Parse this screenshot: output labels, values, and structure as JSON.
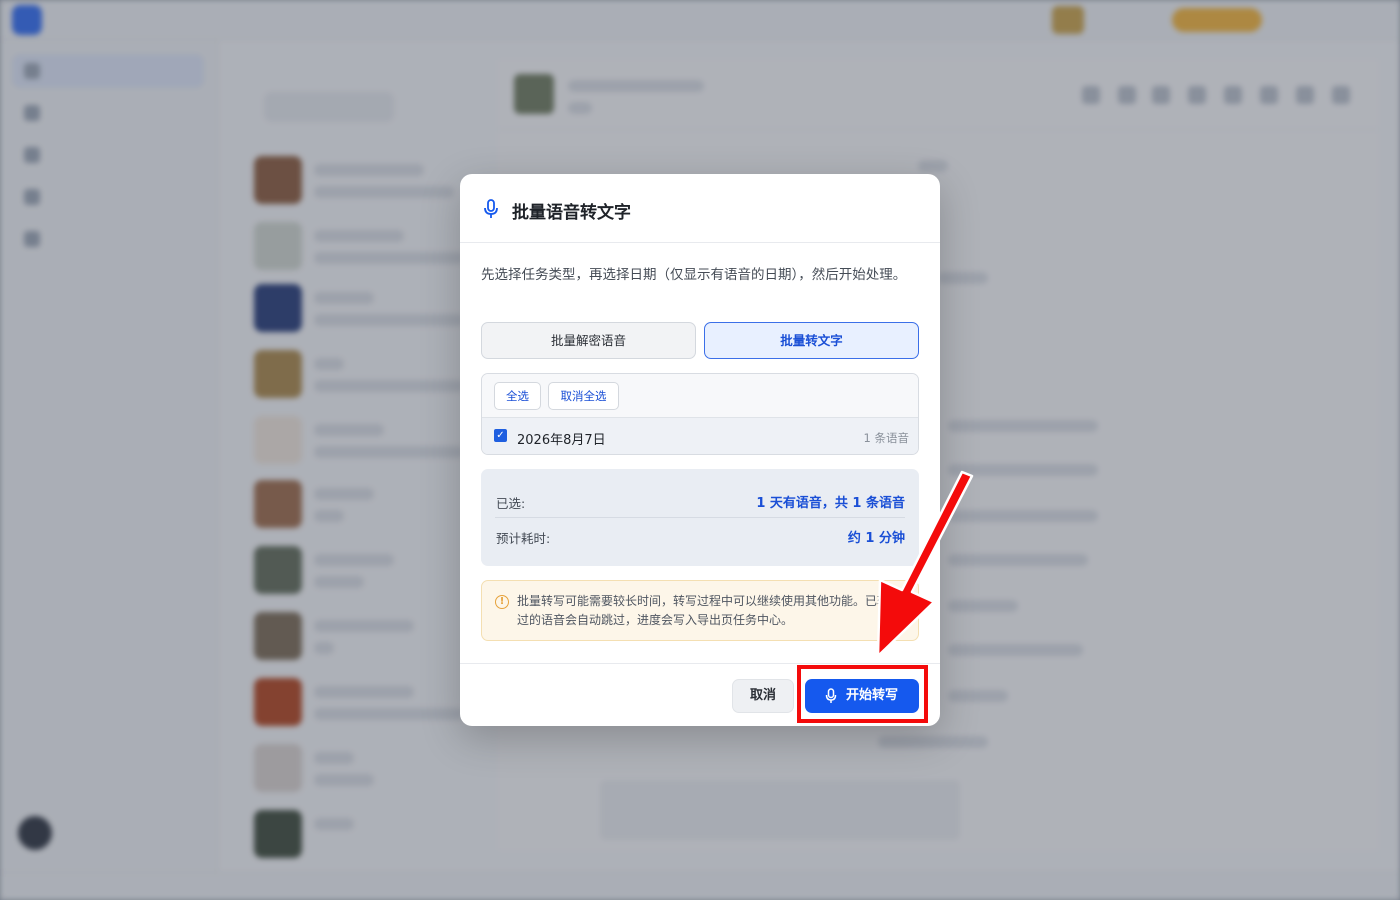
{
  "modal": {
    "title": "批量语音转文字",
    "description": "先选择任务类型，再选择日期（仅显示有语音的日期），然后开始处理。",
    "type_buttons": {
      "decrypt": "批量解密语音",
      "transcribe": "批量转文字",
      "selected": "transcribe"
    },
    "date_toolbar": {
      "select_all": "全选",
      "deselect_all": "取消全选"
    },
    "dates": [
      {
        "label": "2026年8月7日",
        "count": "1 条语音",
        "checked": true
      }
    ],
    "summary": {
      "selected_label": "已选:",
      "selected_value": "1 天有语音，共 1 条语音",
      "time_label": "预计耗时:",
      "time_value": "约 1 分钟"
    },
    "warning": "批量转写可能需要较长时间，转写过程中可以继续使用其他功能。已转写过的语音会自动跳过，进度会写入导出页任务中心。",
    "cancel_label": "取消",
    "start_label": "开始转写"
  },
  "colors": {
    "primary": "#1559ee",
    "annotation_red": "#f40b0b",
    "warning": "#e6a23c"
  },
  "icons": {
    "title": "microphone-icon",
    "start": "microphone-icon",
    "warning": "info-warning-icon",
    "checkbox": "checkbox-checked-icon"
  }
}
